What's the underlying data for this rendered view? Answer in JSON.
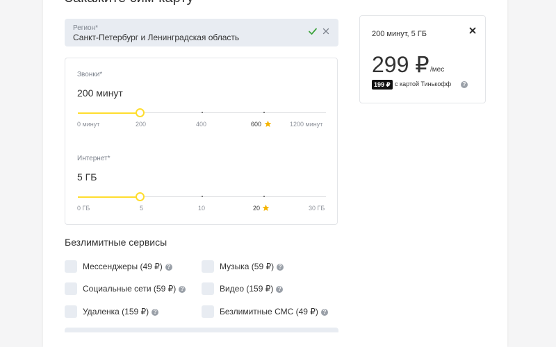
{
  "header": {
    "title": "Закажите сим-карту"
  },
  "region": {
    "label": "Регион*",
    "value": "Санкт-Петербург и Ленинградская область",
    "check_icon": "check-icon",
    "clear_icon": "close-icon",
    "accent": "#3fa43f"
  },
  "calls": {
    "label": "Звонки*",
    "value": "200 минут",
    "selected_fraction": 0.25,
    "ticks": [
      "0 минут",
      "200",
      "400",
      "600",
      "1200 минут"
    ],
    "highlighted_tick": "600"
  },
  "internet": {
    "label": "Интернет*",
    "value": "5 ГБ",
    "selected_fraction": 0.25,
    "ticks": [
      "0 ГБ",
      "5",
      "10",
      "20",
      "30 ГБ"
    ],
    "highlighted_tick": "20"
  },
  "services": {
    "title": "Безлимитные сервисы",
    "items": [
      {
        "label": "Мессенджеры (49 ₽)",
        "checked": false
      },
      {
        "label": "Музыка (59 ₽)",
        "checked": false
      },
      {
        "label": "Социальные сети (59 ₽)",
        "checked": false
      },
      {
        "label": "Видео (159 ₽)",
        "checked": false
      },
      {
        "label": "Удаленка (159 ₽)",
        "checked": false
      },
      {
        "label": "Безлимитные СМС (49 ₽)",
        "checked": false
      }
    ],
    "help_glyph": "?"
  },
  "summary": {
    "plan": "200 минут, 5 ГБ",
    "price": "299 ₽",
    "period": "/мес",
    "promo_price": "199 ₽",
    "promo_text": "с картой Тинькофф",
    "close_icon": "close-icon"
  },
  "colors": {
    "accent_yellow": "#ffdd2d",
    "star": "#f5b400",
    "field_bg": "#e8ecf2",
    "badge_bg": "#111111"
  }
}
